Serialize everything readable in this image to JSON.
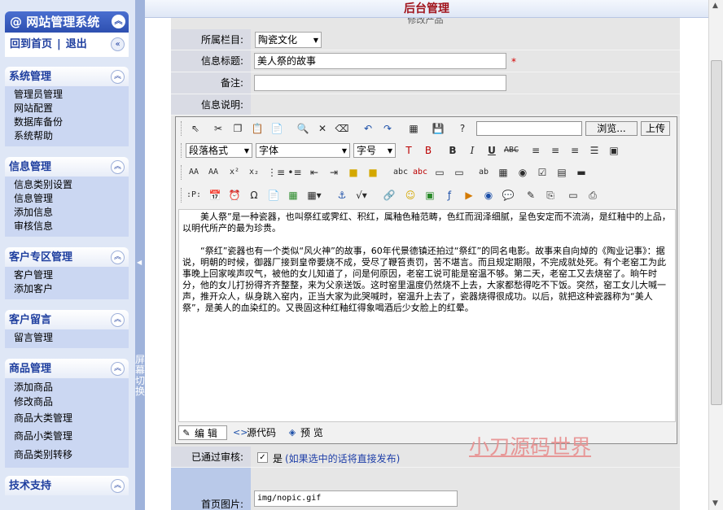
{
  "sidebar": {
    "system_title": "网站管理系统",
    "home_link": "回到首页",
    "separator": "|",
    "logout_link": "退出",
    "groups": [
      {
        "title": "系统管理",
        "items": [
          "管理员管理",
          "网站配置",
          "数据库备份",
          "系统帮助"
        ]
      },
      {
        "title": "信息管理",
        "items": [
          "信息类别设置",
          "信息管理",
          "添加信息",
          "审核信息"
        ]
      },
      {
        "title": "客户专区管理",
        "items": [
          "客户管理",
          "添加客户"
        ]
      },
      {
        "title": "客户留言",
        "items": [
          "留言管理"
        ]
      },
      {
        "title": "商品管理",
        "items": [
          "添加商品",
          "修改商品",
          "商品大类管理",
          "商品小类管理",
          "商品类别转移"
        ]
      },
      {
        "title": "技术支持",
        "items": []
      }
    ],
    "splitter_text": "屏幕切换"
  },
  "header": {
    "title": "后台管理"
  },
  "form": {
    "subtitle": "修改产品",
    "category_label": "所属栏目:",
    "category_value": "陶瓷文化",
    "title_label": "信息标题:",
    "title_value": "美人祭的故事",
    "required_mark": "*",
    "remark_label": "备注:",
    "remark_value": "",
    "desc_label": "信息说明:",
    "approved_label": "已通过审核:",
    "approved_option": "是",
    "approved_hint": "(如果选中的话将直接发布)",
    "approved_checked": true,
    "image_label": "首页图片:",
    "image_value": "img/nopic.gif"
  },
  "editor": {
    "paragraph_format": "段落格式",
    "font_family": "字体",
    "font_size": "字号",
    "browse_button": "浏览...",
    "upload_button": "上传",
    "content_p1": "美人祭”是一种瓷器，也叫祭红或霁红、积红，属釉色釉范畴，色红而润泽细腻，呈色安定而不流淌，是红釉中的上品，以明代所产的最为珍贵。",
    "content_p2": "“祭红”瓷器也有一个类似“风火神”的故事，60年代景德镇还拍过“祭红”的同名电影。故事来自向焯的《陶业记事》：据说，明朝的时候，御器厂接到皇帝要烧不成，受尽了鞭笞责罚，苦不堪言。而且规定期限，不完成就处死。有个老窑工为此事晚上回家唉声叹气，被他的女儿知道了，问是何原因，老窑工说可能是窑温不够。第二天，老窑工又去烧窑了。晌午时分，他的女儿打扮得齐齐整整，来为父亲送饭。这时窑里温度仍然烧不上去，大家都愁得吃不下饭。突然，窑工女儿大喊一声，推开众人，纵身跳入窑内，正当大家为此哭喊时，窑温升上去了，瓷器烧得很成功。以后，就把这种瓷器称为“美人祭”，是美人的血染红的。又畏固这种红釉红得象喝酒后少女脸上的红晕。",
    "mode_edit": "编 辑",
    "mode_source": "源代码",
    "mode_preview": "预 览"
  },
  "watermark": "小刀源码世界"
}
